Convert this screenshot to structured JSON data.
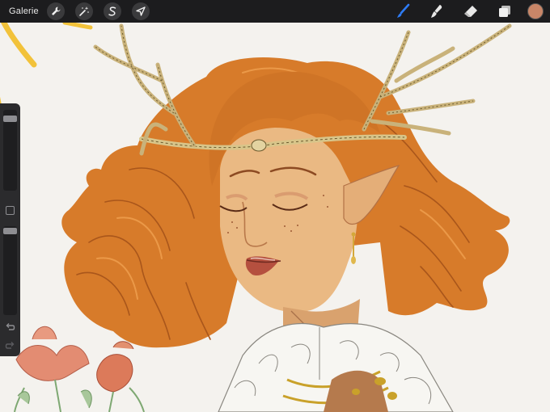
{
  "toolbar": {
    "gallery_label": "Galerie",
    "left_tools": [
      "wrench-icon",
      "magic-wand-icon",
      "selection-s-icon",
      "transform-arrow-icon"
    ],
    "right_tools": [
      "brush-icon",
      "smudge-icon",
      "eraser-icon",
      "layers-icon"
    ],
    "active_tool": "brush-icon",
    "active_color": "#c98668",
    "accent_color": "#2e7cf6"
  },
  "sidebar": {
    "brush_size_level": 0.92,
    "opacity_level": 0.98,
    "modify_button": "square-icon",
    "undo": "undo-icon",
    "redo": "redo-icon"
  }
}
